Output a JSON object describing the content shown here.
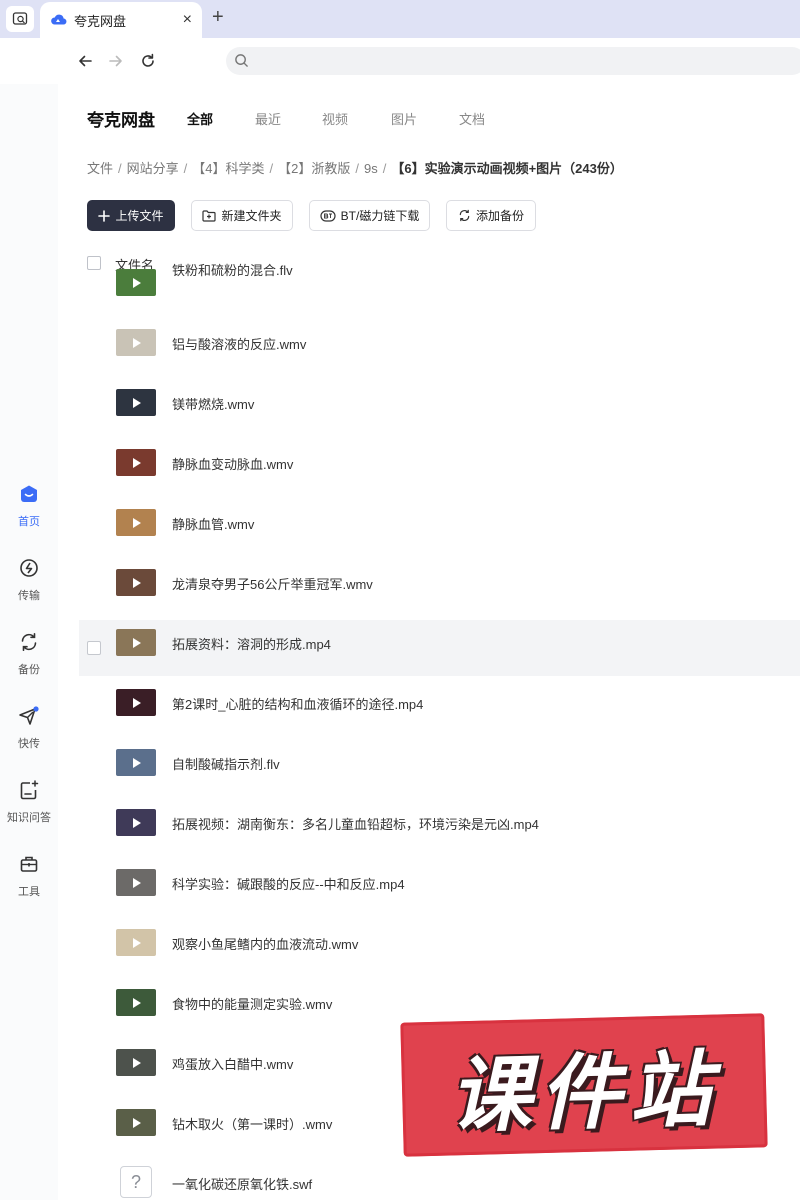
{
  "browser": {
    "tab_title": "夸克网盘",
    "close_glyph": "×",
    "newtab_glyph": "+"
  },
  "sidebar": {
    "items": [
      {
        "label": "首页",
        "icon": "home-icon",
        "active": true
      },
      {
        "label": "传输",
        "icon": "transfer-icon"
      },
      {
        "label": "备份",
        "icon": "backup-icon"
      },
      {
        "label": "快传",
        "icon": "quick-send-icon"
      },
      {
        "label": "知识问答",
        "icon": "qa-icon"
      },
      {
        "label": "工具",
        "icon": "toolbox-icon"
      }
    ]
  },
  "header": {
    "brand": "夸克网盘",
    "categories": [
      "全部",
      "最近",
      "视频",
      "图片",
      "文档"
    ]
  },
  "breadcrumb": {
    "items": [
      "文件",
      "网站分享",
      "【4】科学类",
      "【2】浙教版",
      "9s",
      "【6】实验演示动画视频+图片（243份）"
    ],
    "separator": "/"
  },
  "toolbar": {
    "upload": "上传文件",
    "new_folder": "新建文件夹",
    "bt_download": "BT/磁力链下载",
    "add_backup": "添加备份"
  },
  "table": {
    "header_name": "文件名"
  },
  "files": [
    {
      "name": "铁粉和硫粉的混合.flv",
      "thumb_color": "#4b7d3c",
      "type": "video"
    },
    {
      "name": "铝与酸溶液的反应.wmv",
      "thumb_color": "#c9c3b6",
      "type": "video"
    },
    {
      "name": "镁带燃烧.wmv",
      "thumb_color": "#2d3440",
      "type": "video"
    },
    {
      "name": "静脉血变动脉血.wmv",
      "thumb_color": "#7a3a2e",
      "type": "video"
    },
    {
      "name": "静脉血管.wmv",
      "thumb_color": "#b2824f",
      "type": "video"
    },
    {
      "name": "龙清泉夺男子56公斤举重冠军.wmv",
      "thumb_color": "#6b4a3a",
      "type": "video"
    },
    {
      "name": "拓展资料：溶洞的形成.mp4",
      "thumb_color": "#8a7658",
      "type": "video"
    },
    {
      "name": "第2课时_心脏的结构和血液循环的途径.mp4",
      "thumb_color": "#3a1e26",
      "type": "video"
    },
    {
      "name": "自制酸碱指示剂.flv",
      "thumb_color": "#5b6f8c",
      "type": "video"
    },
    {
      "name": "拓展视频：湖南衡东：多名儿童血铅超标，环境污染是元凶.mp4",
      "thumb_color": "#3f3a58",
      "type": "video"
    },
    {
      "name": "科学实验：碱跟酸的反应--中和反应.mp4",
      "thumb_color": "#6c6a68",
      "type": "video"
    },
    {
      "name": "观察小鱼尾鳍内的血液流动.wmv",
      "thumb_color": "#d2c4a8",
      "type": "video"
    },
    {
      "name": "食物中的能量测定实验.wmv",
      "thumb_color": "#3d5a3a",
      "type": "video"
    },
    {
      "name": "鸡蛋放入白醋中.wmv",
      "thumb_color": "#4d524c",
      "type": "video"
    },
    {
      "name": "钻木取火（第一课时）.wmv",
      "thumb_color": "#5a5f48",
      "type": "video"
    },
    {
      "name": "一氧化碳还原氧化铁.swf",
      "thumb_color": "#ffffff",
      "type": "unknown",
      "thumb_glyph": "?"
    }
  ],
  "watermark": {
    "text": "课件站"
  },
  "colors": {
    "accent": "#3b6cf6",
    "primary_button": "#2d3142",
    "titlebar": "#dfe2f5",
    "watermark": "#e0424e"
  }
}
